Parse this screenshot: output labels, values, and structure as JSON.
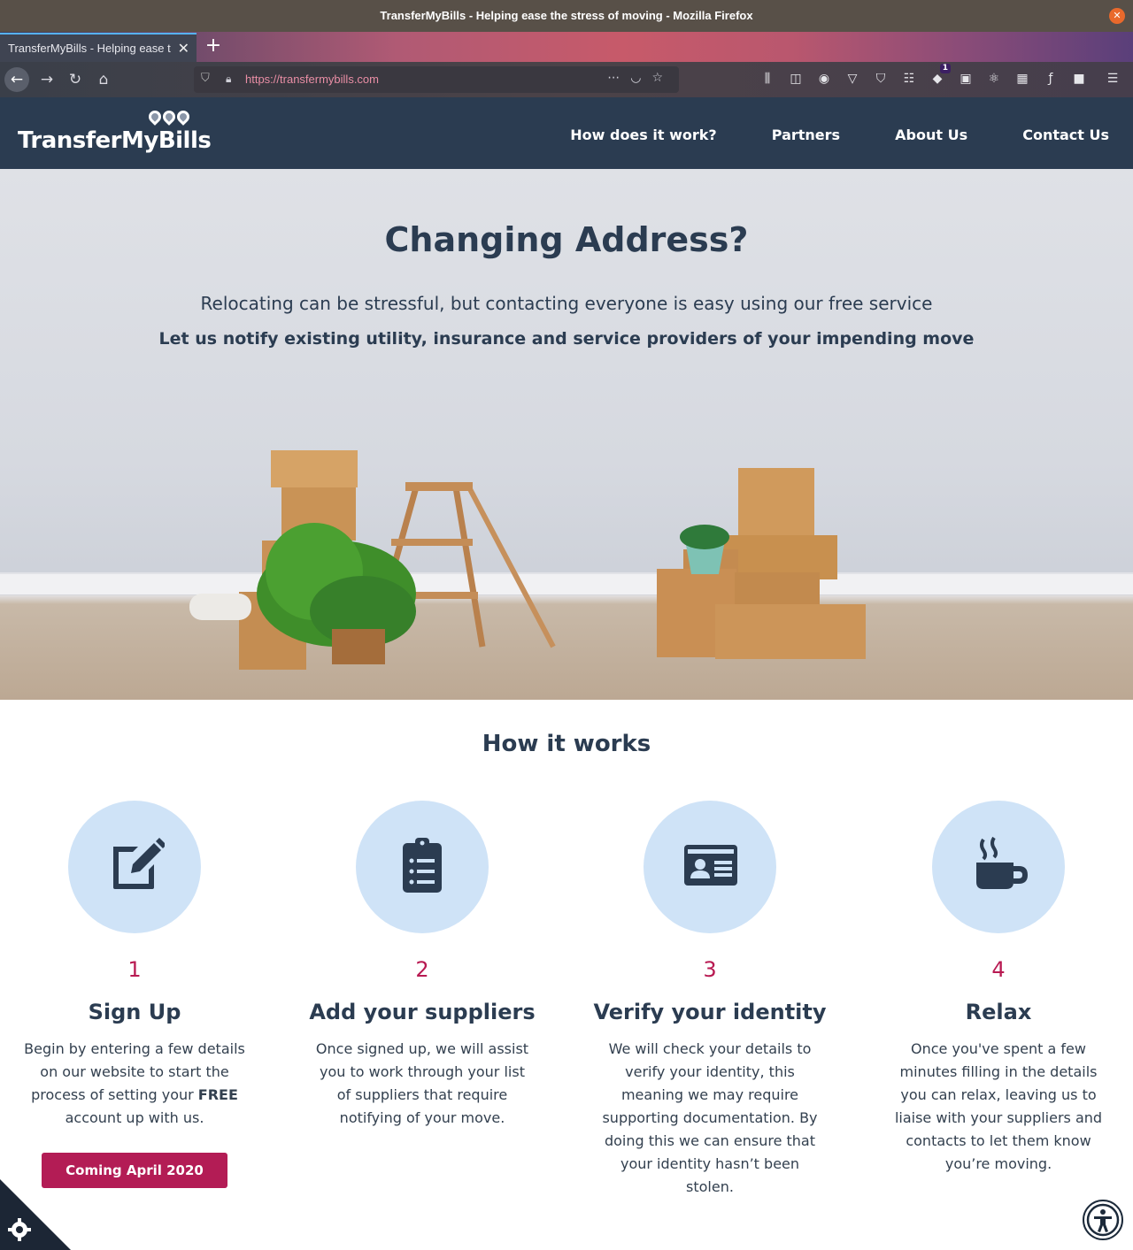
{
  "browser": {
    "window_title": "TransferMyBills - Helping ease the stress of moving - Mozilla Firefox",
    "tab_title": "TransferMyBills - Helping ease the stress of moving",
    "url": "https://transfermybills.com",
    "extension_badge": "1"
  },
  "site": {
    "logo_text": "TransferMyBills",
    "nav": [
      "How does it work?",
      "Partners",
      "About Us",
      "Contact Us"
    ]
  },
  "hero": {
    "title": "Changing Address?",
    "subtitle": "Relocating can be stressful, but contacting everyone is easy using our free service",
    "tagline": "Let us notify existing utility, insurance and service providers of your impending move"
  },
  "how_it_works": {
    "title": "How it works",
    "steps": [
      {
        "number": "1",
        "icon": "edit-icon",
        "title": "Sign Up",
        "desc_before": "Begin by entering a few details on our website to start the process of setting your ",
        "desc_bold": "FREE",
        "desc_after": " account up with us.",
        "button": "Coming April 2020"
      },
      {
        "number": "2",
        "icon": "clipboard-list-icon",
        "title": "Add your suppliers",
        "desc": "Once signed up, we will assist you to work through your list of suppliers that require notifying of your move."
      },
      {
        "number": "3",
        "icon": "id-card-icon",
        "title": "Verify your identity",
        "desc": "We will check your details to verify your identity, this meaning we may require supporting documentation. By doing this we can ensure that your identity hasn’t been stolen."
      },
      {
        "number": "4",
        "icon": "coffee-cup-icon",
        "title": "Relax",
        "desc": "Once you've spent a few minutes filling in the details you can relax, leaving us to liaise with your suppliers and contacts to let them know you’re moving."
      }
    ]
  },
  "colors": {
    "header_bg": "#2b3c51",
    "accent": "#b31c55",
    "icon_circle": "#cfe3f7"
  }
}
